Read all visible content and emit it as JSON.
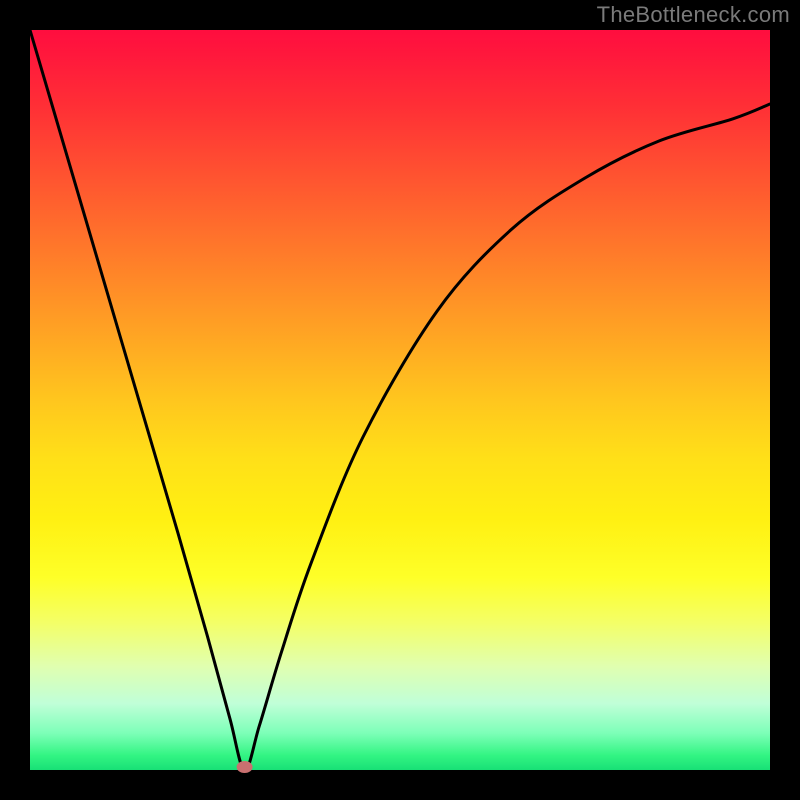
{
  "watermark": "TheBottleneck.com",
  "colors": {
    "frame": "#000000",
    "top": "#ff0d3f",
    "mid": "#ffe018",
    "bottom": "#18e076",
    "curve": "#000000",
    "dot": "#c97070"
  },
  "chart_data": {
    "type": "line",
    "title": "",
    "xlabel": "",
    "ylabel": "",
    "xlim": [
      0,
      100
    ],
    "ylim": [
      0,
      100
    ],
    "grid": false,
    "legend": false,
    "minimum_marker": {
      "x": 29,
      "y": 0
    },
    "series": [
      {
        "name": "curve",
        "x": [
          0,
          5,
          10,
          15,
          20,
          24,
          27,
          29,
          31,
          34,
          38,
          45,
          55,
          65,
          75,
          85,
          95,
          100
        ],
        "y": [
          100,
          83,
          66,
          49,
          32,
          18,
          7,
          0,
          6,
          16,
          28,
          45,
          62,
          73,
          80,
          85,
          88,
          90
        ]
      }
    ]
  }
}
